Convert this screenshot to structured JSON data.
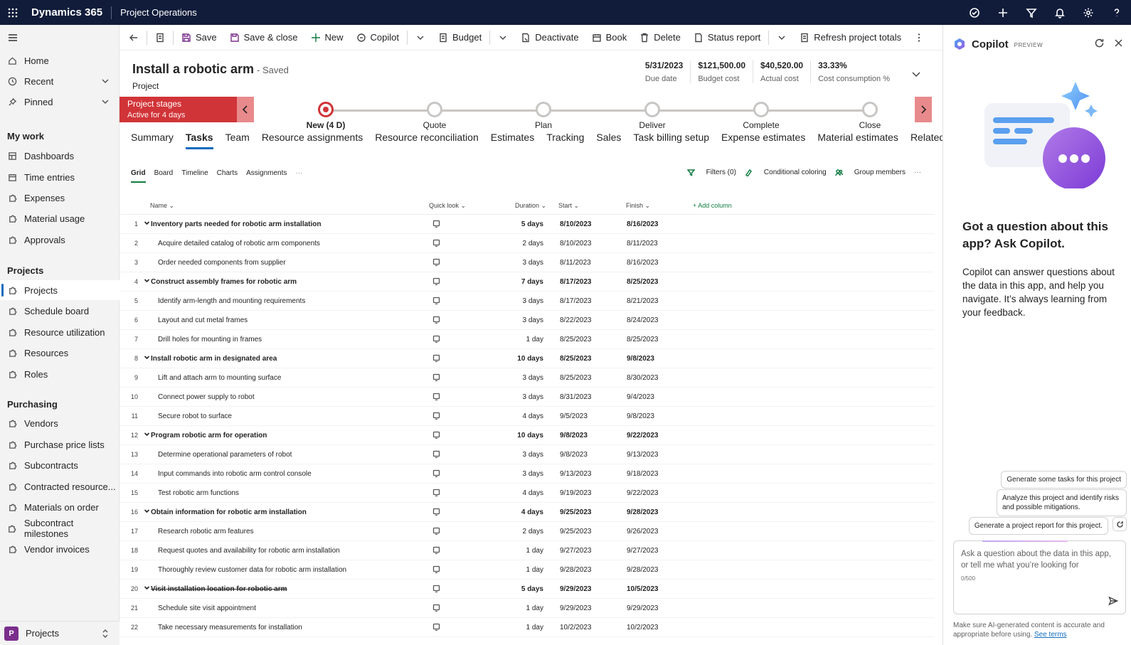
{
  "topbar": {
    "brand": "Dynamics 365",
    "app_name": "Project Operations"
  },
  "leftnav": {
    "home": "Home",
    "recent": "Recent",
    "pinned": "Pinned",
    "my_work_heading": "My work",
    "my_work": [
      "Dashboards",
      "Time entries",
      "Expenses",
      "Material usage",
      "Approvals"
    ],
    "projects_heading": "Projects",
    "projects": [
      "Projects",
      "Schedule board",
      "Resource utilization",
      "Resources",
      "Roles"
    ],
    "purchasing_heading": "Purchasing",
    "purchasing": [
      "Vendors",
      "Purchase price lists",
      "Subcontracts",
      "Contracted resource...",
      "Materials on order",
      "Subcontract milestones",
      "Vendor invoices"
    ],
    "area_badge": "P",
    "area_label": "Projects"
  },
  "commandbar": {
    "save": "Save",
    "save_close": "Save & close",
    "new": "New",
    "copilot": "Copilot",
    "budget": "Budget",
    "deactivate": "Deactivate",
    "book": "Book",
    "delete": "Delete",
    "status_report": "Status report",
    "refresh_totals": "Refresh project totals"
  },
  "record": {
    "title": "Install a robotic arm",
    "saved": "- Saved",
    "entity": "Project"
  },
  "kpis": [
    {
      "value": "5/31/2023",
      "label": "Due date"
    },
    {
      "value": "$121,500.00",
      "label": "Budget cost"
    },
    {
      "value": "$40,520.00",
      "label": "Actual cost"
    },
    {
      "value": "33.33%",
      "label": "Cost consumption %"
    }
  ],
  "bpf": {
    "label": "Project stages",
    "sublabel": "Active for 4 days",
    "stages": [
      "New (4 D)",
      "Quote",
      "Plan",
      "Deliver",
      "Complete",
      "Close"
    ],
    "current_index": 0,
    "color": "#d13438"
  },
  "tabs": [
    "Summary",
    "Tasks",
    "Team",
    "Resource assignments",
    "Resource reconciliation",
    "Estimates",
    "Tracking",
    "Sales",
    "Task billing setup",
    "Expense estimates",
    "Material estimates",
    "Related"
  ],
  "selected_tab": "Tasks",
  "subtabs": [
    "Grid",
    "Board",
    "Timeline",
    "Charts",
    "Assignments"
  ],
  "subtools": {
    "filters": "Filters (0)",
    "conditional": "Conditional coloring",
    "group": "Group members"
  },
  "grid": {
    "headers": {
      "name": "Name",
      "quicklook": "Quick look",
      "duration": "Duration",
      "start": "Start",
      "finish": "Finish",
      "add_column": "Add column"
    },
    "rows": [
      {
        "n": "1",
        "name": "Inventory parts needed for robotic arm installation",
        "dur": "5 days",
        "start": "8/10/2023",
        "finish": "8/16/2023",
        "summary": true
      },
      {
        "n": "2",
        "name": "Acquire detailed catalog of robotic arm components",
        "dur": "2 days",
        "start": "8/10/2023",
        "finish": "8/11/2023"
      },
      {
        "n": "3",
        "name": "Order needed components from supplier",
        "dur": "3 days",
        "start": "8/11/2023",
        "finish": "8/16/2023"
      },
      {
        "n": "4",
        "name": "Construct assembly frames for robotic arm",
        "dur": "7 days",
        "start": "8/17/2023",
        "finish": "8/25/2023",
        "summary": true
      },
      {
        "n": "5",
        "name": "Identify arm-length and mounting requirements",
        "dur": "3 days",
        "start": "8/17/2023",
        "finish": "8/21/2023"
      },
      {
        "n": "6",
        "name": "Layout and cut metal frames",
        "dur": "3 days",
        "start": "8/22/2023",
        "finish": "8/24/2023"
      },
      {
        "n": "7",
        "name": "Drill holes for mounting in frames",
        "dur": "1 day",
        "start": "8/25/2023",
        "finish": "8/25/2023"
      },
      {
        "n": "8",
        "name": "Install robotic arm in designated area",
        "dur": "10 days",
        "start": "8/25/2023",
        "finish": "9/8/2023",
        "summary": true
      },
      {
        "n": "9",
        "name": "Lift and attach arm to mounting surface",
        "dur": "3 days",
        "start": "8/25/2023",
        "finish": "8/30/2023"
      },
      {
        "n": "10",
        "name": "Connect power supply to robot",
        "dur": "3 days",
        "start": "8/31/2023",
        "finish": "9/4/2023"
      },
      {
        "n": "11",
        "name": "Secure robot to surface",
        "dur": "4 days",
        "start": "9/5/2023",
        "finish": "9/8/2023"
      },
      {
        "n": "12",
        "name": "Program robotic arm for operation",
        "dur": "10 days",
        "start": "9/8/2023",
        "finish": "9/22/2023",
        "summary": true
      },
      {
        "n": "13",
        "name": "Determine operational parameters of robot",
        "dur": "3 days",
        "start": "9/8/2023",
        "finish": "9/13/2023"
      },
      {
        "n": "14",
        "name": "Input commands into robotic arm control console",
        "dur": "3 days",
        "start": "9/13/2023",
        "finish": "9/18/2023"
      },
      {
        "n": "15",
        "name": "Test robotic arm functions",
        "dur": "4 days",
        "start": "9/19/2023",
        "finish": "9/22/2023"
      },
      {
        "n": "16",
        "name": "Obtain information for robotic arm installation",
        "dur": "4 days",
        "start": "9/25/2023",
        "finish": "9/28/2023",
        "summary": true
      },
      {
        "n": "17",
        "name": "Research robotic arm features",
        "dur": "2 days",
        "start": "9/25/2023",
        "finish": "9/26/2023"
      },
      {
        "n": "18",
        "name": "Request quotes and availability for robotic arm installation",
        "dur": "1 day",
        "start": "9/27/2023",
        "finish": "9/27/2023"
      },
      {
        "n": "19",
        "name": "Thoroughly review customer data for robotic arm installation",
        "dur": "1 day",
        "start": "9/28/2023",
        "finish": "9/28/2023"
      },
      {
        "n": "20",
        "name": "Visit installation location for robotic arm",
        "dur": "5 days",
        "start": "9/29/2023",
        "finish": "10/5/2023",
        "summary": true,
        "strike": true
      },
      {
        "n": "21",
        "name": "Schedule site visit appointment",
        "dur": "1 day",
        "start": "9/29/2023",
        "finish": "9/29/2023"
      },
      {
        "n": "22",
        "name": "Take necessary measurements for installation",
        "dur": "1 day",
        "start": "10/2/2023",
        "finish": "10/2/2023"
      }
    ]
  },
  "copilot": {
    "title": "Copilot",
    "preview": "PREVIEW",
    "question": "Got a question about this app? Ask Copilot.",
    "description": "Copilot can answer questions about the data in this app, and help you navigate. It’s always learning from your feedback.",
    "suggestions": [
      "Generate some tasks for this project",
      "Analyze this project and identify risks and possible mitigations.",
      "Generate a project report for this project."
    ],
    "input_placeholder": "Ask a question about the data in this app, or tell me what you’re looking for",
    "char_count": "0/500",
    "footer": "Make sure AI-generated content is accurate and appropriate before using.",
    "footer_link": "See terms"
  }
}
